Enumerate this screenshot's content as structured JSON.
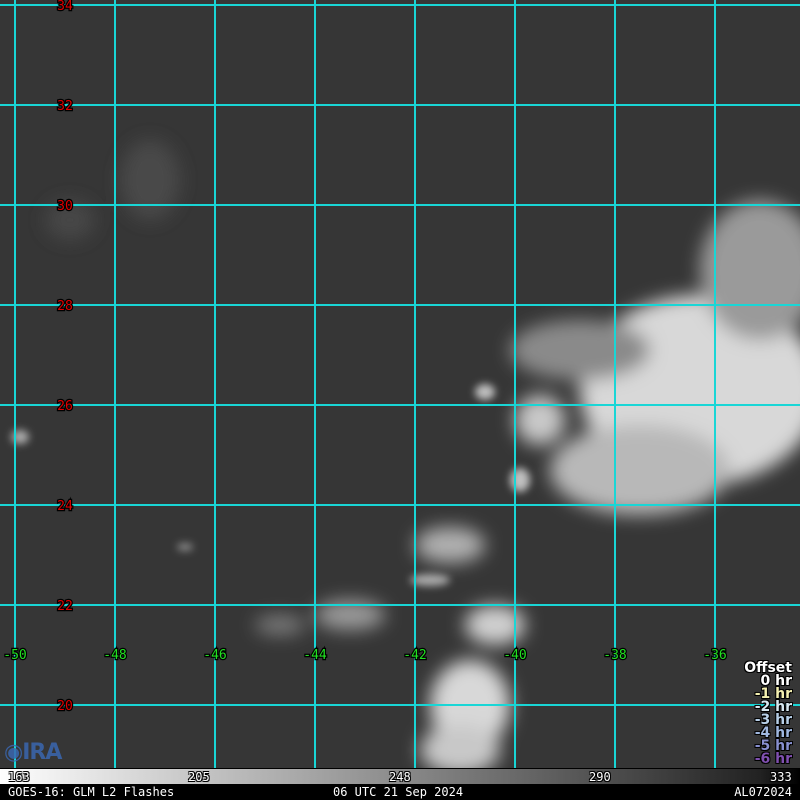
{
  "map": {
    "latitudes": [
      "34",
      "32",
      "30",
      "28",
      "26",
      "24",
      "22",
      "20"
    ],
    "longitudes": [
      "-50",
      "-48",
      "-46",
      "-44",
      "-42",
      "-40",
      "-38",
      "-36"
    ],
    "grid_color": "#19d6d6",
    "lat_label_color": "#e00000",
    "lon_label_color": "#22e022"
  },
  "legend": {
    "title": "Offset",
    "items": [
      {
        "label": "0 hr",
        "color": "#ffffff"
      },
      {
        "label": "-1 hr",
        "color": "#f4f0b0"
      },
      {
        "label": "-2 hr",
        "color": "#d8e8f0"
      },
      {
        "label": "-3 hr",
        "color": "#b8d0e8"
      },
      {
        "label": "-4 hr",
        "color": "#a0b8e0"
      },
      {
        "label": "-5 hr",
        "color": "#8890d0"
      },
      {
        "label": "-6 hr",
        "color": "#8050b0"
      }
    ]
  },
  "colorbar": {
    "ticks": [
      "163",
      "205",
      "248",
      "290",
      "333"
    ]
  },
  "footer": {
    "left": "GOES-16: GLM L2 Flashes",
    "center": "06 UTC 21 Sep 2024",
    "right": "AL072024"
  },
  "logo_text": "CIRA"
}
